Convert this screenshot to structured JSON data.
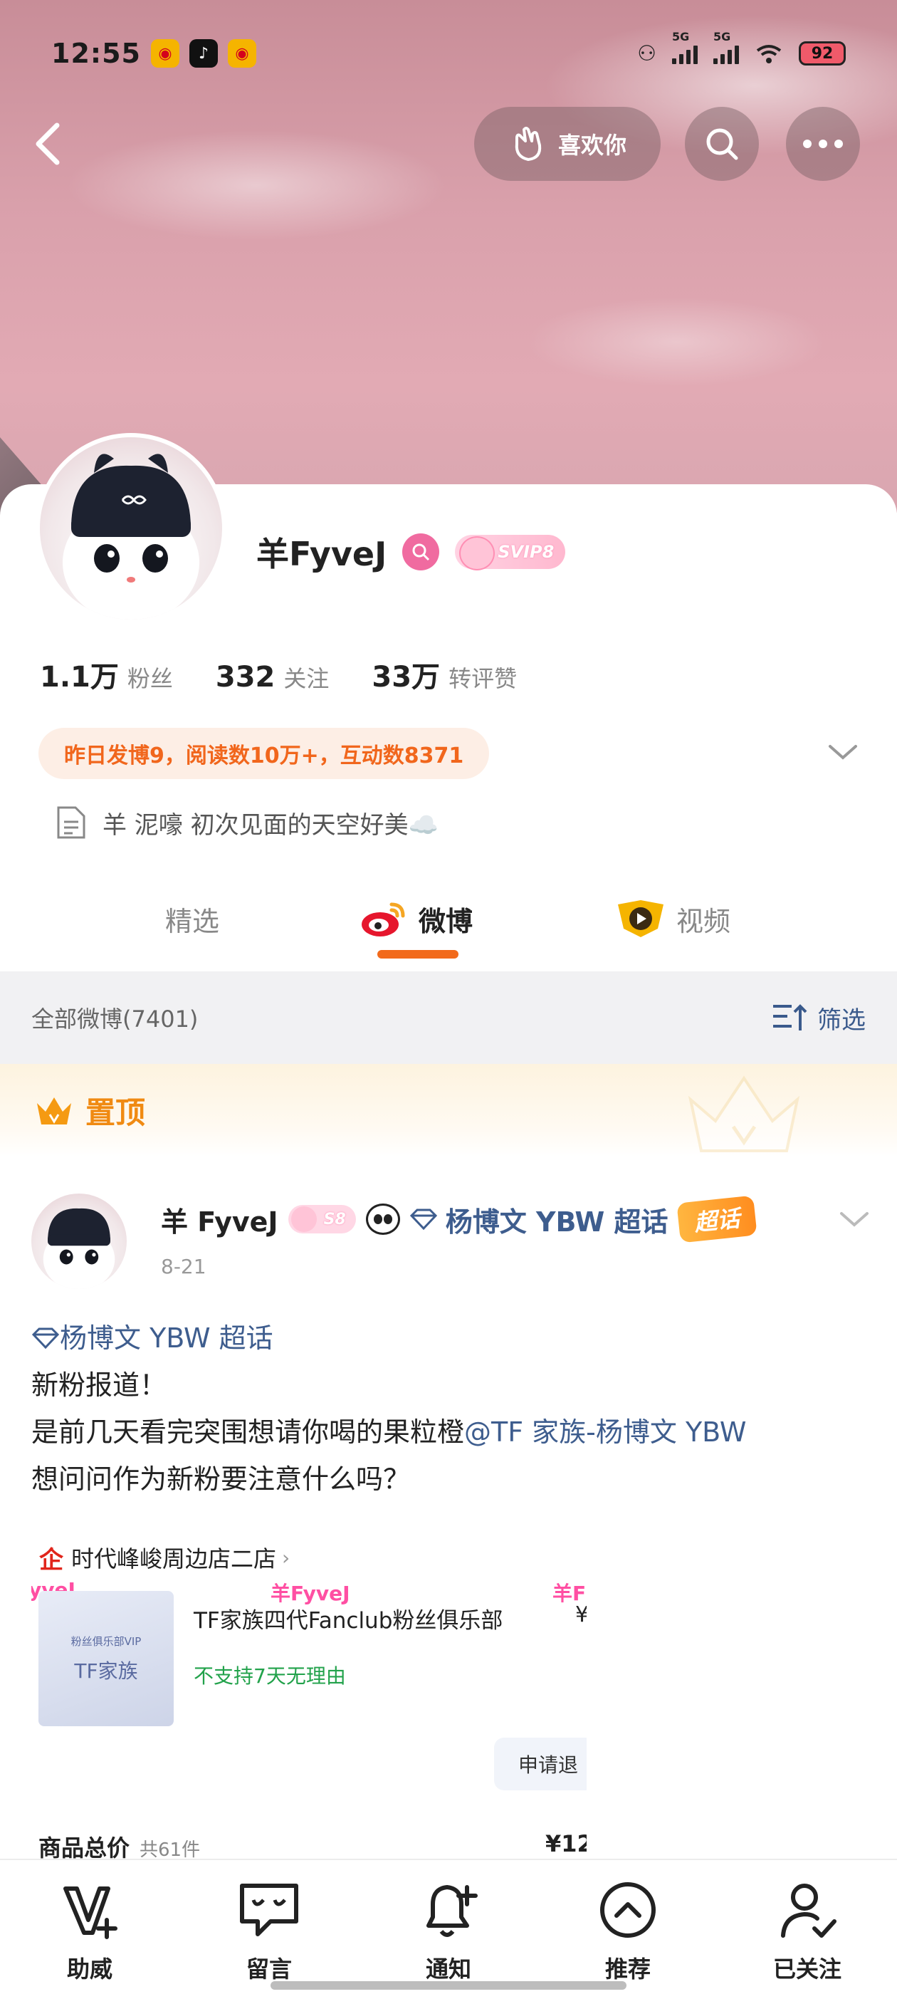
{
  "status_bar": {
    "time": "12:55",
    "net1": "5G",
    "net2": "5G",
    "battery": "92"
  },
  "nav": {
    "like_label": "喜欢你"
  },
  "profile": {
    "name": "羊FyveJ",
    "svip_label": "SVIP8",
    "stats": [
      {
        "num": "1.1万",
        "label": "粉丝"
      },
      {
        "num": "332",
        "label": "关注"
      },
      {
        "num": "33万",
        "label": "转评赞"
      }
    ],
    "highlight": "昨日发博9，阅读数10万+，互动数8371",
    "bio": "羊  泥嚎  初次见面的天空好美☁️"
  },
  "tabs": [
    {
      "label": "精选"
    },
    {
      "label": "微博"
    },
    {
      "label": "视频"
    }
  ],
  "filter": {
    "title": "全部微博(7401)",
    "button": "筛选"
  },
  "pinned": {
    "label": "置顶"
  },
  "post": {
    "author": "羊 FyveJ",
    "badge": "S8",
    "topic": "杨博文 YBW 超话",
    "chaohua": "超话",
    "date": "8-21",
    "tag_line": "杨博文 YBW 超话",
    "line1": "新粉报道！",
    "line2_prefix": "是前几天看完突围想请你喝的果粒橙",
    "line2_mention": "@TF 家族-杨博文 YBW",
    "line3": "想问问作为新粉要注意什么吗？"
  },
  "order": {
    "shop": "时代峰峻周边店二店",
    "watermark_left": "yveJ",
    "watermark_mid": "羊FyveJ",
    "watermark_right": "羊F",
    "img_small": "粉丝俱乐部VIP",
    "img_big": "TF家族",
    "title": "TF家族四代Fanclub粉丝俱乐部",
    "price": "¥",
    "note": "不支持7天无理由",
    "refund": "申请退",
    "total_label": "商品总价",
    "total_count": "共61件",
    "total_value": "¥12"
  },
  "bottom_bar": [
    {
      "label": "助威"
    },
    {
      "label": "留言"
    },
    {
      "label": "通知"
    },
    {
      "label": "推荐"
    },
    {
      "label": "已关注"
    }
  ],
  "colors": {
    "accent_orange": "#f26a1b",
    "link_blue": "#3e5d8e",
    "pink": "#f06ba0"
  }
}
